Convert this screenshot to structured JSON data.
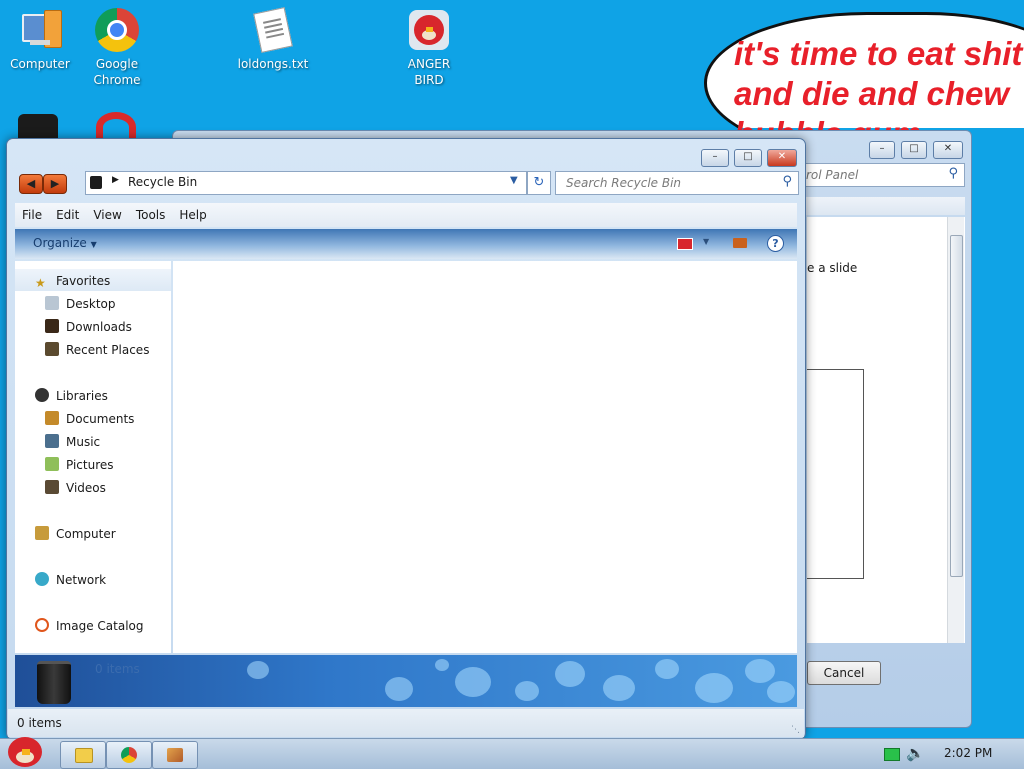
{
  "desktop": {
    "icons": [
      {
        "label": "Computer",
        "icon": "computer-icon"
      },
      {
        "label": "Google\nChrome",
        "icon": "chrome-icon"
      },
      {
        "label": "loldongs.txt",
        "icon": "text-file-icon"
      },
      {
        "label": "ANGER\nBIRD",
        "icon": "angry-bird-icon"
      }
    ],
    "bubble_lines": [
      "it's time to eat shit",
      "and die and chew",
      "bubble gum"
    ]
  },
  "background_window": {
    "search_placeholder": "rol Panel",
    "text_fragment": "e a slide",
    "cancel_label": "Cancel"
  },
  "explorer": {
    "address": "Recycle Bin",
    "search_placeholder": "Search Recycle Bin",
    "menu": [
      "File",
      "Edit",
      "View",
      "Tools",
      "Help"
    ],
    "organize_label": "Organize",
    "nav": {
      "favorites": "Favorites",
      "desktop": "Desktop",
      "downloads": "Downloads",
      "recent": "Recent Places",
      "libraries": "Libraries",
      "documents": "Documents",
      "music": "Music",
      "pictures": "Pictures",
      "videos": "Videos",
      "computer": "Computer",
      "network": "Network",
      "image_catalog": "Image Catalog"
    },
    "details_count": "0 items",
    "status_count": "0 items"
  },
  "taskbar": {
    "time": "2:02 PM"
  },
  "colors": {
    "desktop": "#0fa3e6",
    "bubble_text": "#e8202a",
    "nav_button": "#e0561c"
  }
}
